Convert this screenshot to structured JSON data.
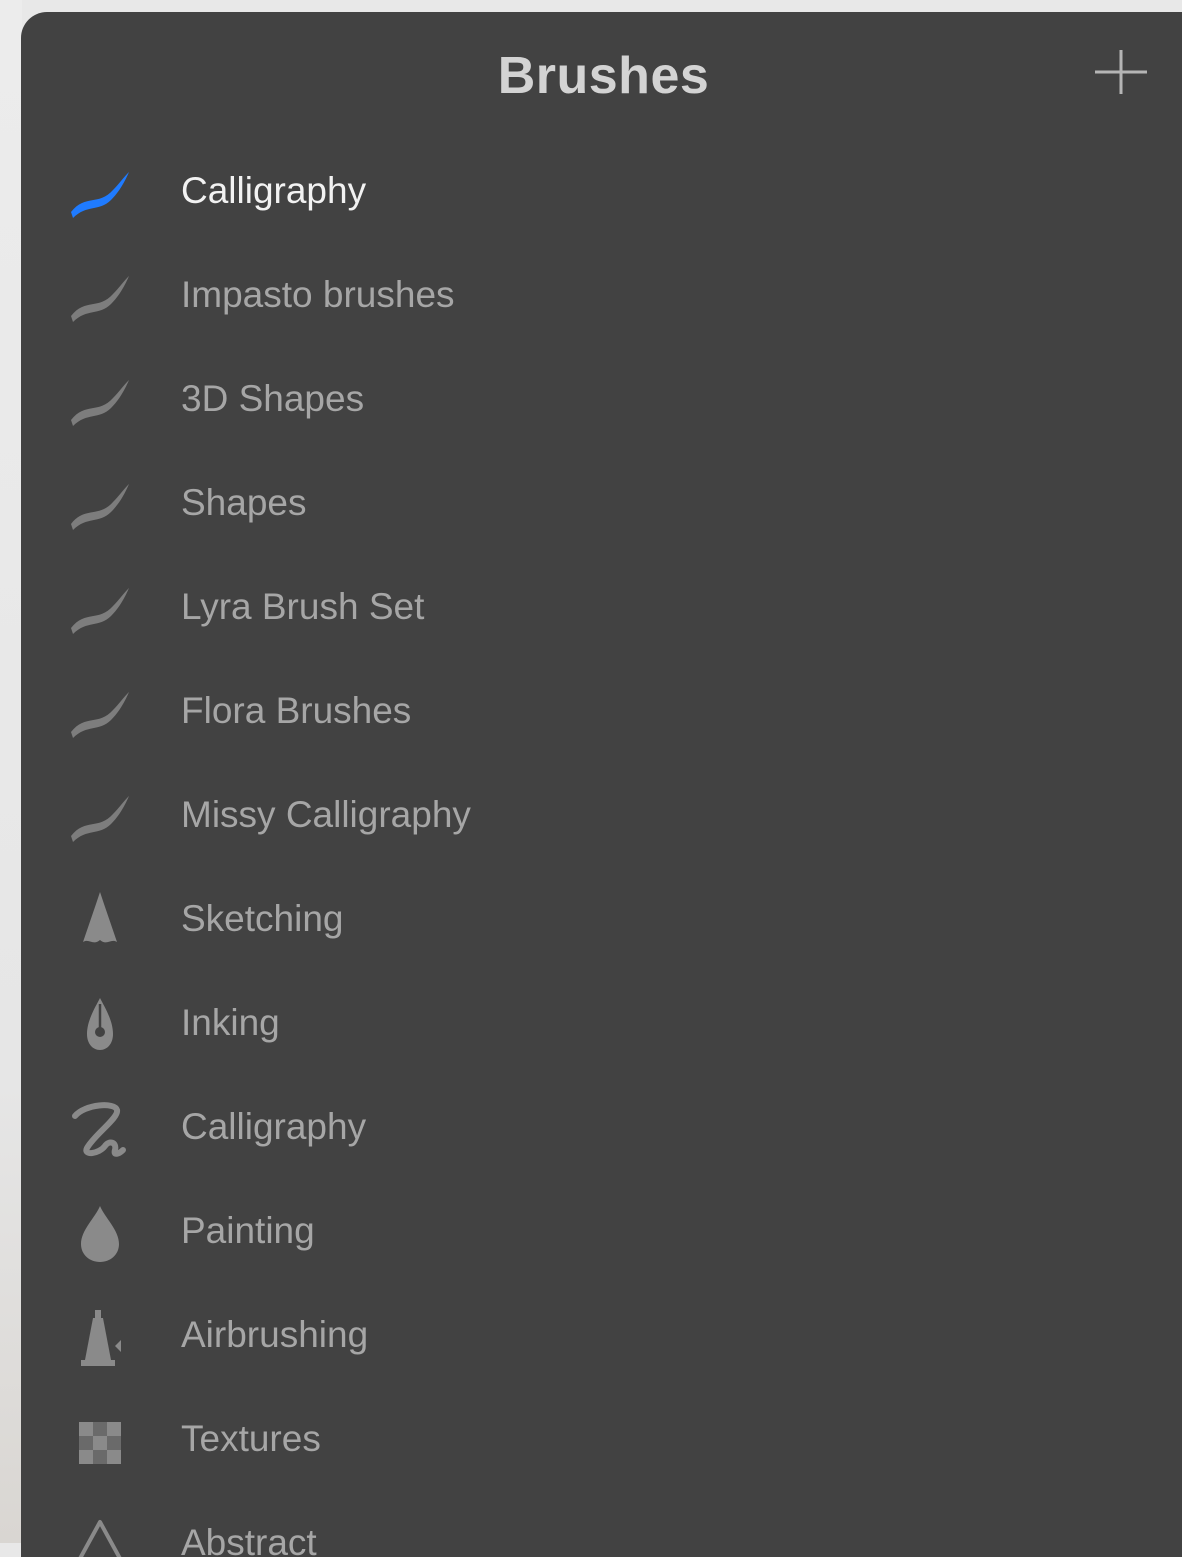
{
  "header": {
    "title": "Brushes",
    "add_icon": "plus-icon"
  },
  "colors": {
    "panel": "#424242",
    "selected_accent": "#1f7bff",
    "icon_gray": "#7d7d7d",
    "label_gray": "#a6a6a6",
    "selected_label": "#f2f2f2"
  },
  "brush_sets": [
    {
      "label": "Calligraphy",
      "icon": "brush-stroke-icon",
      "selected": true
    },
    {
      "label": "Impasto brushes",
      "icon": "brush-stroke-icon"
    },
    {
      "label": "3D Shapes",
      "icon": "brush-stroke-icon"
    },
    {
      "label": "Shapes",
      "icon": "brush-stroke-icon"
    },
    {
      "label": "Lyra Brush Set",
      "icon": "brush-stroke-icon"
    },
    {
      "label": "Flora Brushes",
      "icon": "brush-stroke-icon"
    },
    {
      "label": "Missy Calligraphy",
      "icon": "brush-stroke-icon"
    },
    {
      "label": "Sketching",
      "icon": "pencil-tip-icon"
    },
    {
      "label": "Inking",
      "icon": "pen-nib-icon"
    },
    {
      "label": "Calligraphy",
      "icon": "script-z-icon"
    },
    {
      "label": "Painting",
      "icon": "paint-drop-icon"
    },
    {
      "label": "Airbrushing",
      "icon": "airbrush-icon"
    },
    {
      "label": "Textures",
      "icon": "checker-texture-icon"
    },
    {
      "label": "Abstract",
      "icon": "triangle-icon"
    }
  ]
}
